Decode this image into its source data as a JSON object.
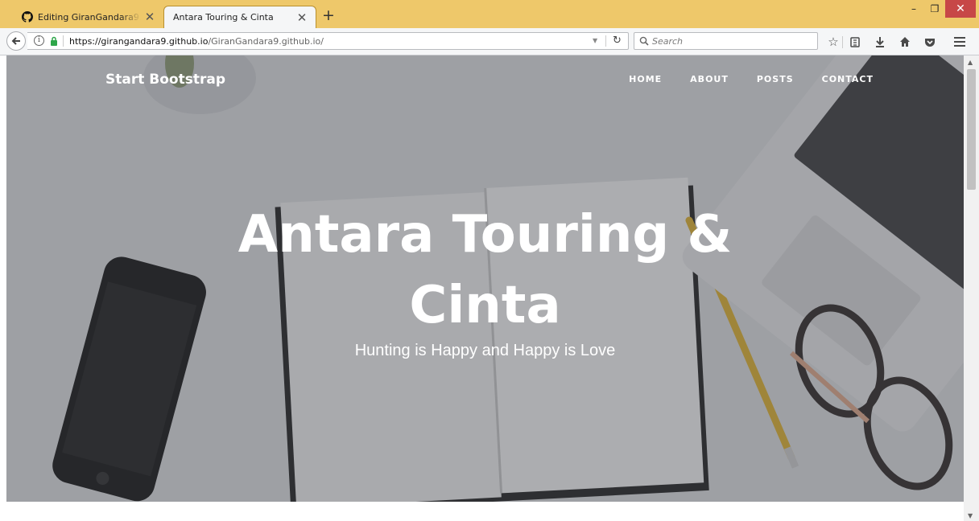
{
  "browser": {
    "tabs": [
      {
        "title": "Editing GiranGandara9.githu",
        "favicon": "github-icon",
        "active": false
      },
      {
        "title": "Antara Touring & Cinta",
        "active": true
      }
    ],
    "new_tab": "+",
    "window_controls": {
      "minimize": "–",
      "maximize": "❐",
      "close": "✕"
    },
    "url": {
      "domain": "https://girangandara9.github.io",
      "path": "/GiranGandara9.github.io/"
    },
    "search_placeholder": "Search",
    "toolbar_icons": [
      "star-icon",
      "reading-list-icon",
      "download-icon",
      "home-icon",
      "pocket-icon",
      "menu-icon"
    ]
  },
  "site": {
    "brand": "Start Bootstrap",
    "nav": [
      "HOME",
      "ABOUT",
      "POSTS",
      "CONTACT"
    ],
    "heading_line1": "Antara Touring &",
    "heading_line2": "Cinta",
    "subheading": "Hunting is Happy and Happy is Love"
  },
  "colors": {
    "titlebar": "#eec86a",
    "close_button": "#c74747",
    "text_on_hero": "#ffffff"
  }
}
